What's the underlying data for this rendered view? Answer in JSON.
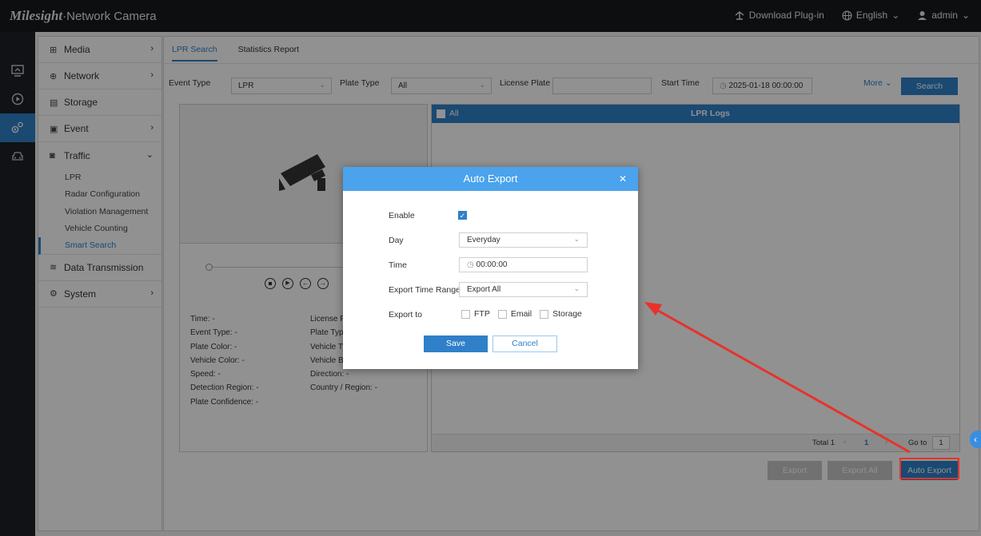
{
  "topbar": {
    "brand_logo": "Milesight",
    "brand_product": "·Network Camera",
    "download_plugin": "Download Plug-in",
    "language": "English",
    "user": "admin"
  },
  "menu": {
    "items": [
      {
        "label": "Media"
      },
      {
        "label": "Network"
      },
      {
        "label": "Storage"
      },
      {
        "label": "Event"
      },
      {
        "label": "Traffic"
      }
    ],
    "traffic_sub": [
      "LPR",
      "Radar Configuration",
      "Violation Management",
      "Vehicle Counting",
      "Smart Search"
    ],
    "after_items": [
      {
        "label": "Data Transmission"
      },
      {
        "label": "System"
      }
    ]
  },
  "tabs": {
    "lpr_search": "LPR Search",
    "statistics_report": "Statistics Report"
  },
  "filters": {
    "event_type_label": "Event Type",
    "event_type_value": "LPR",
    "plate_type_label": "Plate Type",
    "plate_type_value": "All",
    "license_plate_label": "License Plate",
    "start_time_label": "Start Time",
    "start_time_value": "2025-01-18 00:00:00",
    "more": "More",
    "search": "Search"
  },
  "info": {
    "left": [
      "Time: -",
      "Event Type: -",
      "Plate Color: -",
      "Vehicle Color: -",
      "Speed: -",
      "Detection Region: -",
      "Plate Confidence: -"
    ],
    "right": [
      "License P",
      "Plate Type",
      "Vehicle Ty",
      "Vehicle Br",
      "Direction: -",
      "Country / Region: -"
    ]
  },
  "logs": {
    "all": "All",
    "title": "LPR Logs",
    "total": "Total 1",
    "page": "1",
    "goto_label": "Go to",
    "goto_value": "1"
  },
  "bottom": {
    "export": "Export",
    "export_all": "Export All",
    "auto_export": "Auto Export"
  },
  "modal": {
    "title": "Auto Export",
    "enable_label": "Enable",
    "enable_checked": true,
    "day_label": "Day",
    "day_value": "Everyday",
    "time_label": "Time",
    "time_value": "00:00:00",
    "range_label": "Export Time Range",
    "range_value": "Export All",
    "export_to_label": "Export to",
    "export_to": [
      "FTP",
      "Email",
      "Storage"
    ],
    "save": "Save",
    "cancel": "Cancel"
  },
  "colors": {
    "accent": "#2f80c8",
    "modal_header": "#4aa3ec",
    "highlight": "#e8322a"
  }
}
